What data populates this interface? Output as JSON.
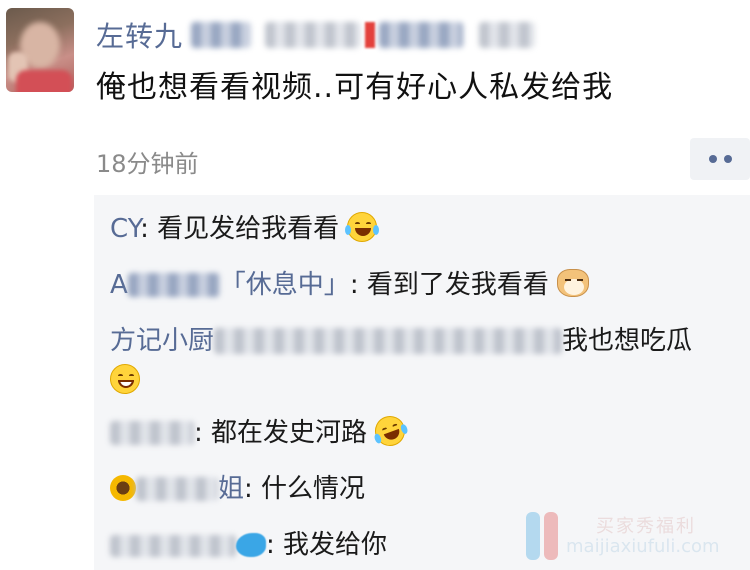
{
  "post": {
    "author_name": "左转九",
    "text": "俺也想看看视频..可有好心人私发给我",
    "time": "18分钟前"
  },
  "comments": [
    {
      "name": "CY",
      "separator": ": ",
      "text": "看见发给我看看",
      "emoji": "laughing-tears"
    },
    {
      "name": "A",
      "name_suffix": "「休息中」",
      "separator": ": ",
      "text": "看到了发我看看",
      "emoji": "dog-face"
    },
    {
      "name": "方记小厨",
      "separator": "",
      "text": "我也想吃瓜",
      "emoji": "grinning-face"
    },
    {
      "name": "",
      "separator": ": ",
      "text": "都在发史河路",
      "emoji": "rolling-laughing"
    },
    {
      "name": "姐",
      "separator": ": ",
      "text": "什么情况",
      "emoji": ""
    },
    {
      "name": "",
      "separator": ": ",
      "text": "我发给你",
      "emoji": ""
    }
  ],
  "watermark": {
    "line1": "买家秀福利",
    "line2": "maijiaxiufuli.com"
  },
  "colors": {
    "link_blue": "#576b95",
    "comment_bg": "#f5f6f8",
    "timestamp_grey": "#8a8a8a"
  }
}
